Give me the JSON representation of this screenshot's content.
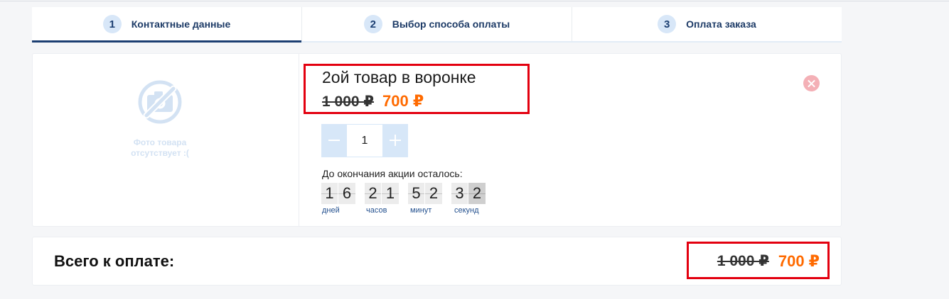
{
  "steps": [
    {
      "number": "1",
      "label": "Контактные данные",
      "active": true
    },
    {
      "number": "2",
      "label": "Выбор способа оплаты",
      "active": false
    },
    {
      "number": "3",
      "label": "Оплата заказа",
      "active": false
    }
  ],
  "product": {
    "no_photo_text": "Фото товара отсутствует :(",
    "title": "2ой товар в воронке",
    "old_price": "1 000 ₽",
    "price": "700 ₽",
    "quantity": "1",
    "timer_caption": "До окончания акции осталось:",
    "timer": [
      {
        "digits": [
          "1",
          "6"
        ],
        "unit": "дней"
      },
      {
        "digits": [
          "2",
          "1"
        ],
        "unit": "часов"
      },
      {
        "digits": [
          "5",
          "2"
        ],
        "unit": "минут"
      },
      {
        "digits": [
          "3",
          "2"
        ],
        "unit": "секунд"
      }
    ]
  },
  "total": {
    "label": "Всего к оплате:",
    "old_price": "1 000 ₽",
    "price": "700 ₽"
  },
  "icons": {
    "no_photo": "no-photo-icon",
    "remove": "close-icon",
    "decrease": "minus-icon",
    "increase": "plus-icon"
  },
  "colors": {
    "accent_price": "#ff6a00",
    "navy": "#1c3f72",
    "step_badge": "#d8e7f8",
    "stepper": "#d7e7f8",
    "remove": "#f4b0b6",
    "annotation": "#e3000f",
    "background": "#f5f6f8"
  }
}
